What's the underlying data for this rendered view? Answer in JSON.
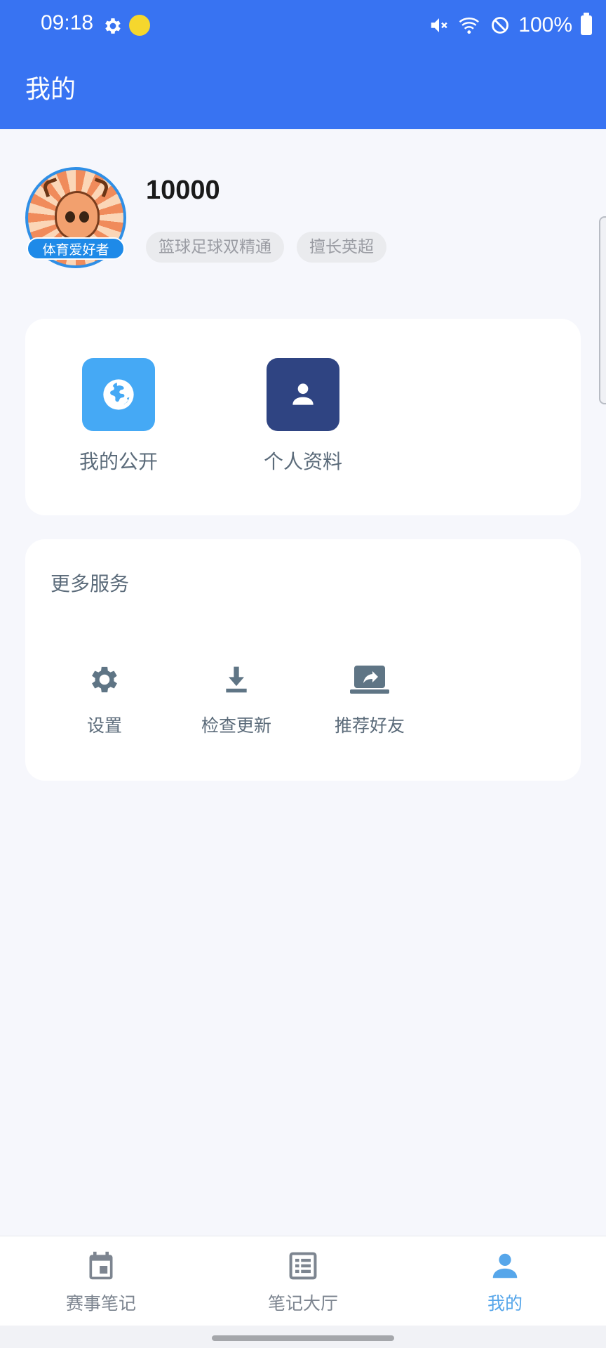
{
  "status_bar": {
    "time": "09:18",
    "battery": "100%"
  },
  "app_bar": {
    "title": "我的"
  },
  "profile": {
    "avatar_badge": "体育爱好者",
    "username": "10000",
    "tags": [
      "篮球足球双精通",
      "擅长英超"
    ]
  },
  "quick_actions": [
    {
      "label": "我的公开",
      "icon": "globe-icon",
      "color": "#45a9f5"
    },
    {
      "label": "个人资料",
      "icon": "person-icon",
      "color": "#2f4482"
    }
  ],
  "more_services": {
    "title": "更多服务",
    "items": [
      {
        "label": "设置",
        "icon": "gear-icon"
      },
      {
        "label": "检查更新",
        "icon": "download-icon"
      },
      {
        "label": "推荐好友",
        "icon": "share-icon"
      }
    ]
  },
  "bottom_nav": {
    "items": [
      {
        "label": "赛事笔记",
        "icon": "calendar-icon",
        "active": false
      },
      {
        "label": "笔记大厅",
        "icon": "list-icon",
        "active": false
      },
      {
        "label": "我的",
        "icon": "person-icon",
        "active": true
      }
    ]
  },
  "colors": {
    "primary": "#3873f2",
    "active_nav": "#56a6ea",
    "muted_icon": "#5f7585"
  }
}
